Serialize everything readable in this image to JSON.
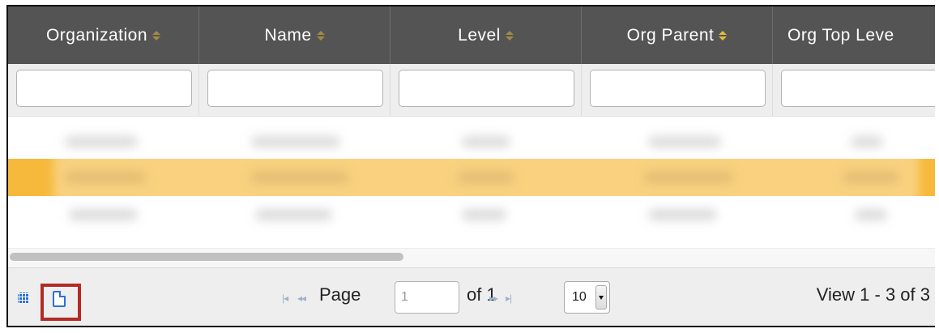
{
  "columns": [
    {
      "label": "Organization",
      "sort_icon": "sort-icon"
    },
    {
      "label": "Name",
      "sort_icon": "sort-icon"
    },
    {
      "label": "Level",
      "sort_icon": "sort-icon"
    },
    {
      "label": "Org Parent",
      "sort_icon": "sort-active-icon"
    },
    {
      "label": "Org Top Leve",
      "sort_icon": "sort-icon"
    }
  ],
  "filters": [
    "",
    "",
    "",
    "",
    ""
  ],
  "rows_note_hidden": true,
  "pager": {
    "page_label": "Page",
    "page_value": "1",
    "of_label": "of 1",
    "rows_per_page": "10",
    "view_text": "View 1 - 3 of 3",
    "icons": [
      "grid-settings-icon",
      "export-document-icon",
      "first-page-icon",
      "prev-page-icon",
      "next-page-icon",
      "last-page-icon"
    ]
  },
  "colors": {
    "header": "#545454",
    "highlight_row": "#f6b93b",
    "accent": "#2d6fd6",
    "callout": "#b42a25"
  }
}
